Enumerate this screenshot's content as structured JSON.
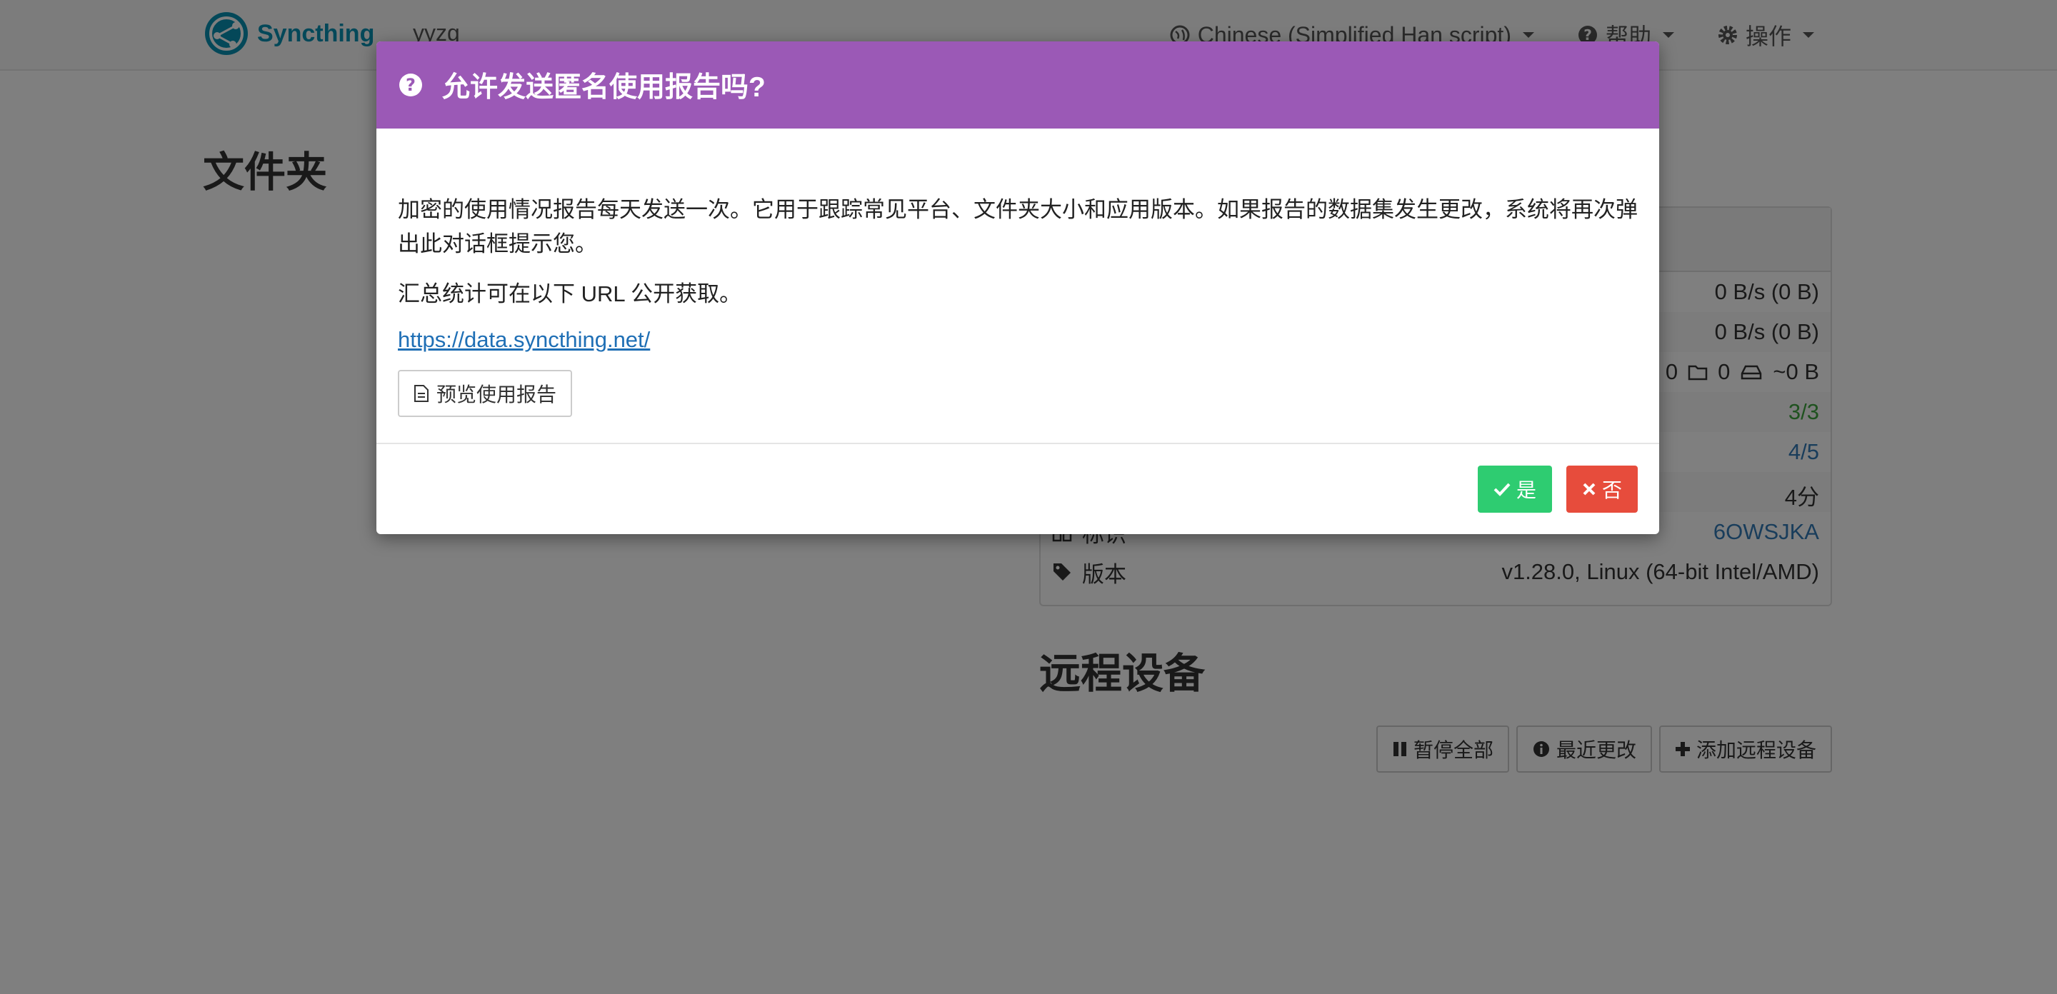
{
  "navbar": {
    "brand": "Syncthing",
    "device_name": "yyzg",
    "language": "Chinese (Simplified Han script)",
    "help": "帮助",
    "actions": "操作"
  },
  "main": {
    "folders_heading": "文件夹",
    "remote_devices_heading": "远程设备",
    "status_rows": [
      {
        "label": "",
        "value": "0 B/s (0 B)"
      },
      {
        "label": "",
        "value": "0 B/s (0 B)"
      },
      {
        "label": "",
        "value_files": "0",
        "value_dirs": "0",
        "value_size": "~0 B"
      },
      {
        "label": "",
        "value": "3/3"
      },
      {
        "label": "",
        "value": "4/5"
      },
      {
        "label": "",
        "value": "4分"
      },
      {
        "label": "标识",
        "value": "6OWSJKA"
      },
      {
        "label": "版本",
        "value": "v1.28.0, Linux (64-bit Intel/AMD)"
      }
    ],
    "buttons": {
      "pause_all": "暂停全部",
      "recent_changes": "最近更改",
      "add_device": "添加远程设备"
    }
  },
  "modal": {
    "title": "允许发送匿名使用报告吗?",
    "body_1": "加密的使用情况报告每天发送一次。它用于跟踪常见平台、文件夹大小和应用版本。如果报告的数据集发生更改，系统将再次弹出此对话框提示您。",
    "body_2": "汇总统计可在以下 URL 公开获取。",
    "link": "https://data.syncthing.net/",
    "preview_button": "预览使用报告",
    "yes_button": "是",
    "no_button": "否"
  },
  "colors": {
    "modal_header": "#9b59b6",
    "yes": "#2ecc71",
    "no": "#e74c3c",
    "brand": "#0891b2"
  }
}
